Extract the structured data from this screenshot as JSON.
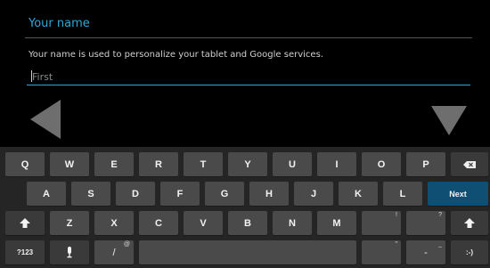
{
  "setup": {
    "title": "Your name",
    "description": "Your name is used to personalize your tablet and Google services.",
    "first_name_placeholder": "First"
  },
  "icons": {
    "back": "left-triangle-arrow-icon",
    "collapse": "down-triangle-arrow-icon",
    "shift": "shift-up-arrow-icon",
    "mic": "microphone-icon",
    "delete": "backspace-icon"
  },
  "colors": {
    "accent": "#2fa8d8",
    "next_key": "#0f4f73"
  },
  "keyboard": {
    "row1": [
      "Q",
      "W",
      "E",
      "R",
      "T",
      "Y",
      "U",
      "I",
      "O",
      "P"
    ],
    "row2": [
      "A",
      "S",
      "D",
      "F",
      "G",
      "H",
      "J",
      "K",
      "L"
    ],
    "row3": [
      "Z",
      "X",
      "C",
      "V",
      "B",
      "N",
      "M"
    ],
    "next_label": "Next",
    "symbols_label": "?123",
    "slash_label": "/",
    "slash_hint": "@",
    "comma_hint": "!",
    "period_hint": "?",
    "apostrophe_hint": "\"",
    "dash_label": "-",
    "dash_hint": "_",
    "smiley_label": ":-)"
  }
}
